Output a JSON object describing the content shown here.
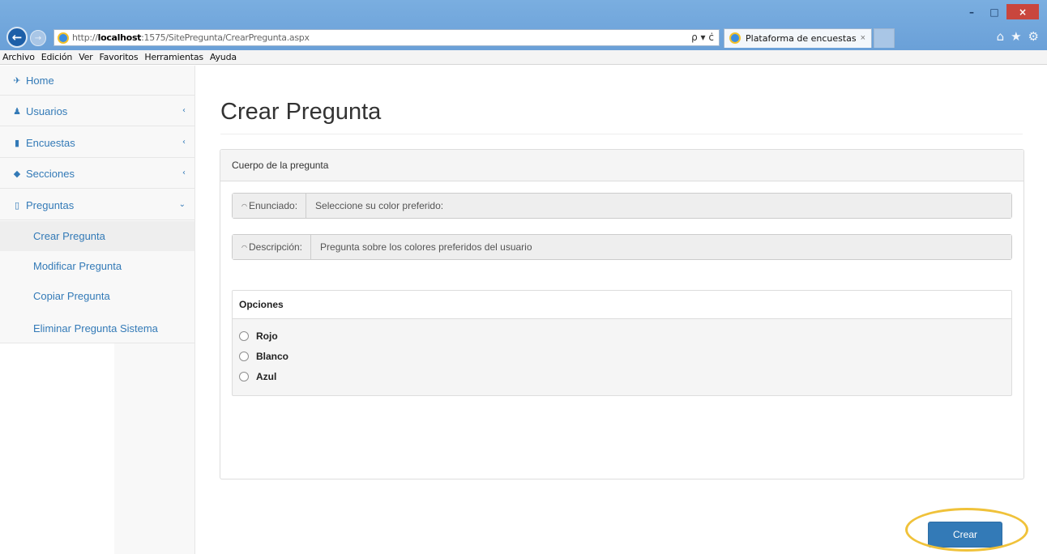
{
  "browser": {
    "url_prefix": "http://",
    "url_host": "localhost",
    "url_path": ":1575/SitePregunta/CrearPregunta.aspx",
    "address_tools": "ρ ▾ ċ",
    "tab_title": "Plataforma de encuestas",
    "tab_close": "×",
    "window_buttons": [
      "–",
      "□",
      "×"
    ],
    "menu": [
      "Archivo",
      "Edición",
      "Ver",
      "Favoritos",
      "Herramientas",
      "Ayuda"
    ],
    "right_icons": [
      "home-icon",
      "star-icon",
      "gear-icon"
    ]
  },
  "sidebar": {
    "items": [
      {
        "label": "Home",
        "icon": "home-icon"
      },
      {
        "label": "Usuarios",
        "icon": "users-icon"
      },
      {
        "label": "Encuestas",
        "icon": "bookmark-icon"
      },
      {
        "label": "Secciones",
        "icon": "tags-icon"
      },
      {
        "label": "Preguntas",
        "icon": "bookmark-outline-icon"
      }
    ],
    "subitems": [
      "Crear Pregunta",
      "Modificar Pregunta",
      "Copiar Pregunta",
      "Eliminar Pregunta Sistema"
    ],
    "active_subitem": "Crear Pregunta"
  },
  "main": {
    "title": "Crear Pregunta",
    "panel_heading": "Cuerpo de la pregunta",
    "enunciado": {
      "label": "Enunciado:",
      "value": "Seleccione su color preferido:"
    },
    "descripcion": {
      "label": "Descripción:",
      "value": "Pregunta sobre los colores preferidos del usuario"
    },
    "opciones": {
      "heading": "Opciones",
      "options": [
        "Rojo",
        "Blanco",
        "Azul"
      ]
    },
    "submit_label": "Crear"
  },
  "colors": {
    "link": "#337ab7",
    "primary_button": "#337ab7",
    "highlight_ring": "#f0c23a",
    "title_bar": "#6aa0d8"
  }
}
